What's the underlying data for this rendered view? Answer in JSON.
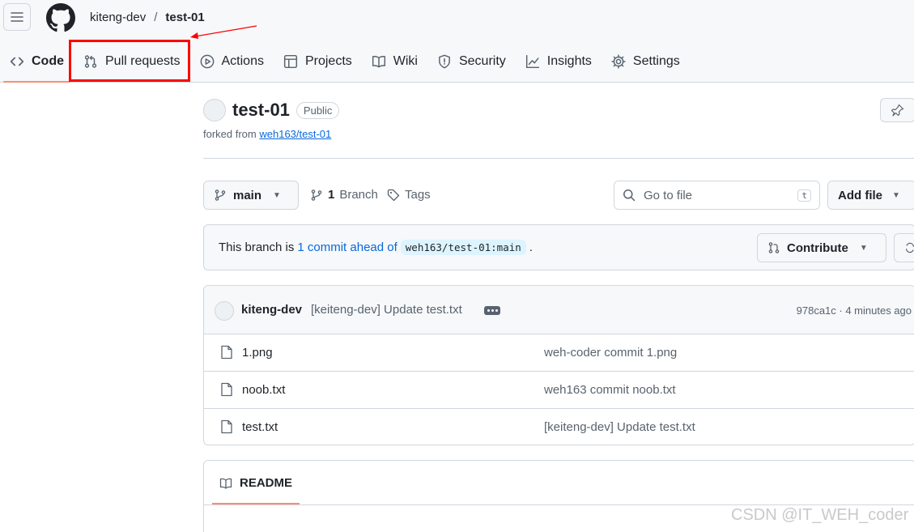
{
  "breadcrumb": {
    "owner": "kiteng-dev",
    "separator": "/",
    "repo": "test-01"
  },
  "tabs": [
    {
      "label": "Code",
      "icon": "code-icon",
      "active": true
    },
    {
      "label": "Pull requests",
      "icon": "git-pull-request-icon",
      "active": false
    },
    {
      "label": "Actions",
      "icon": "play-circle-icon",
      "active": false
    },
    {
      "label": "Projects",
      "icon": "table-icon",
      "active": false
    },
    {
      "label": "Wiki",
      "icon": "book-icon",
      "active": false
    },
    {
      "label": "Security",
      "icon": "shield-icon",
      "active": false
    },
    {
      "label": "Insights",
      "icon": "graph-icon",
      "active": false
    },
    {
      "label": "Settings",
      "icon": "gear-icon",
      "active": false
    }
  ],
  "repo": {
    "name": "test-01",
    "visibility": "Public",
    "forked_prefix": "forked from",
    "forked_from": "weh163/test-01"
  },
  "toolbar": {
    "branch": "main",
    "branch_count": "1",
    "branch_label": "Branch",
    "tags_label": "Tags",
    "search_placeholder": "Go to file",
    "search_shortcut": "t",
    "add_file": "Add file"
  },
  "ahead": {
    "prefix": "This branch is",
    "link": "1 commit ahead of",
    "ref": "weh163/test-01:main",
    "suffix": ".",
    "contribute": "Contribute"
  },
  "latest_commit": {
    "author": "kiteng-dev",
    "message": "[keiteng-dev] Update test.txt",
    "meta": "978ca1c · 4 minutes ago"
  },
  "files": [
    {
      "name": "1.png",
      "message": "weh-coder commit 1.png"
    },
    {
      "name": "noob.txt",
      "message": "weh163 commit noob.txt"
    },
    {
      "name": "test.txt",
      "message": "[keiteng-dev] Update test.txt"
    }
  ],
  "readme": {
    "label": "README"
  },
  "watermark": "CSDN @IT_WEH_coder",
  "colors": {
    "accent": "#fd8c73",
    "link": "#0969da",
    "annotation": "#ff0000",
    "header_bg": "#f6f8fa",
    "border": "#d0d7de"
  }
}
